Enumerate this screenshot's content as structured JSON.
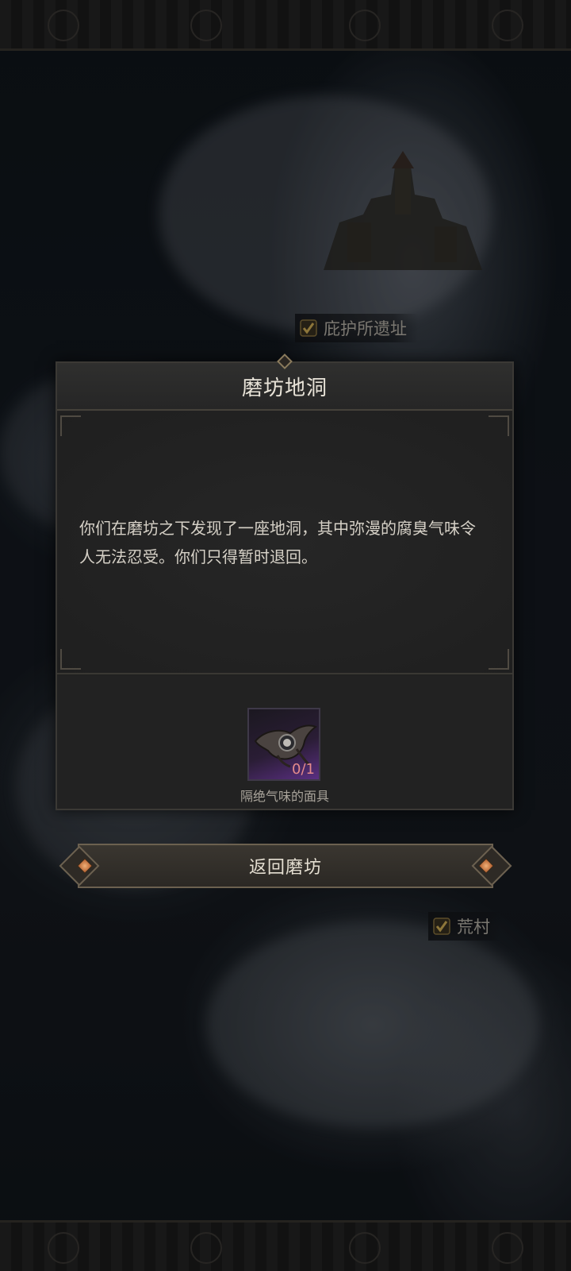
{
  "map": {
    "locations": [
      {
        "label": "庇护所遗址",
        "icon": "check-icon"
      },
      {
        "label": "荒村",
        "icon": "check-icon"
      }
    ]
  },
  "dialog": {
    "title": "磨坊地洞",
    "message": "你们在磨坊之下发现了一座地洞，其中弥漫的腐臭气味令人无法忍受。你们只得暂时退回。",
    "required_item": {
      "name": "隔绝气味的面具",
      "count": "0/1",
      "icon": "mask-icon"
    }
  },
  "button": {
    "label": "返回磨坊"
  },
  "colors": {
    "accent": "#6c6150",
    "item_count": "#e48b8b",
    "item_rarity_purple": "#5a2f82"
  }
}
